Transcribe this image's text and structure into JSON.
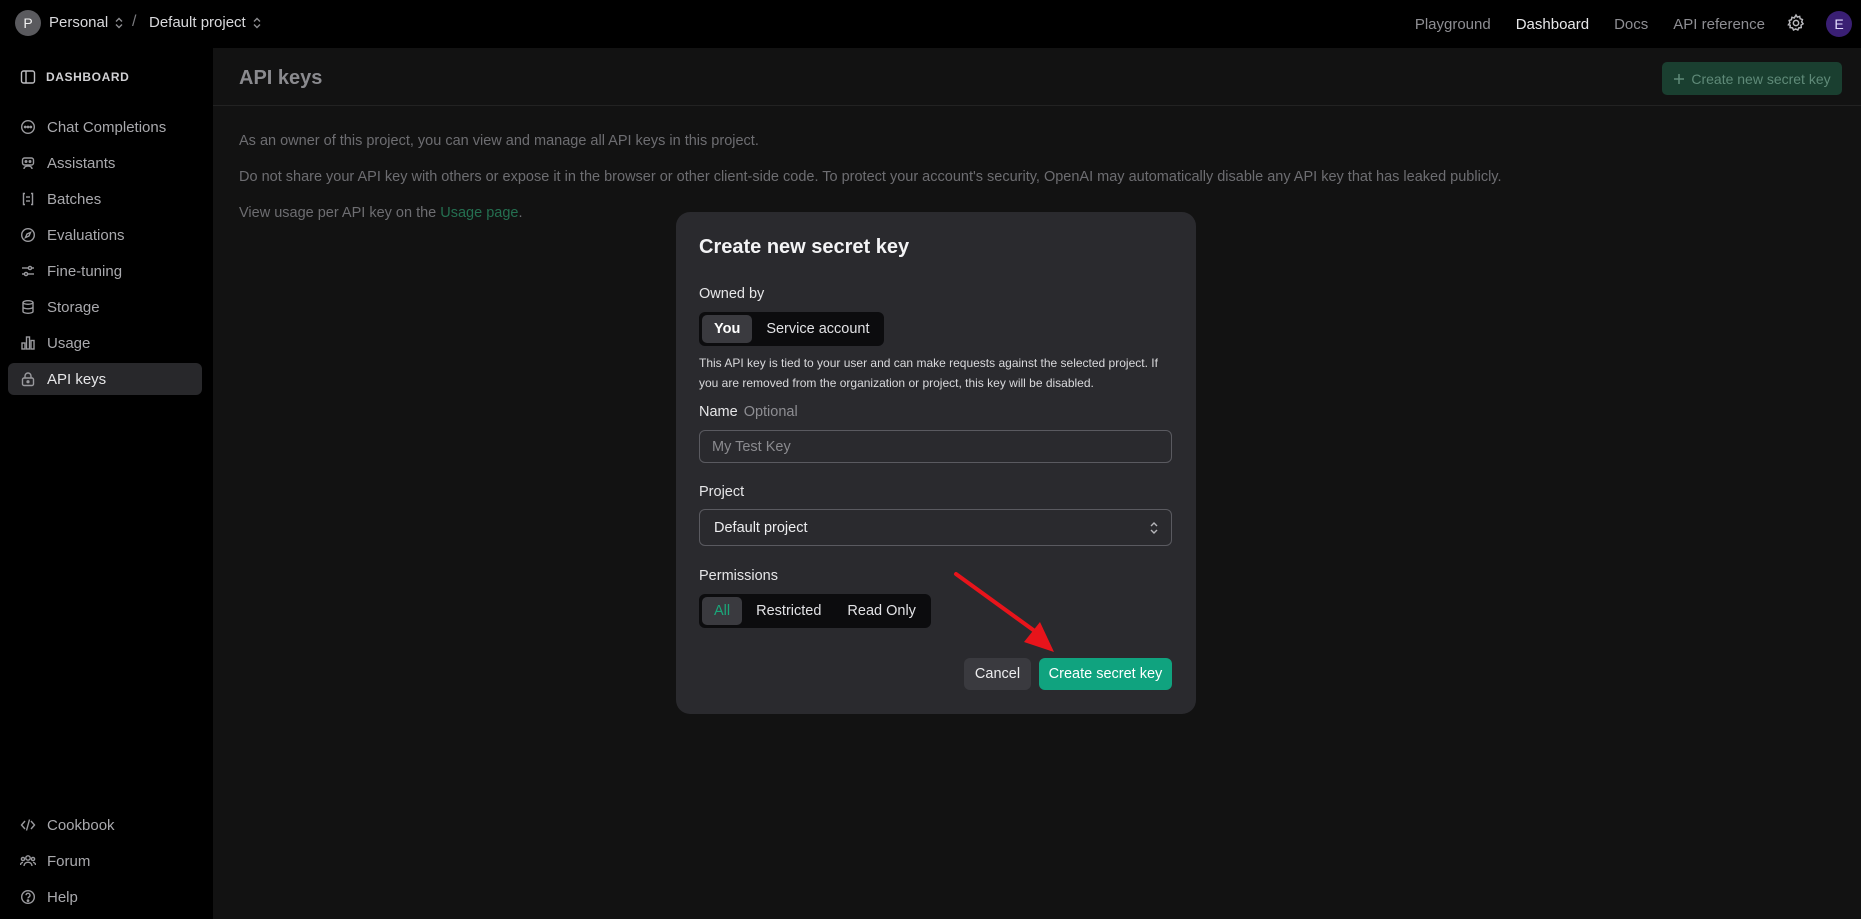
{
  "topbar": {
    "org_initial": "P",
    "org_name": "Personal",
    "separator": "/",
    "project_name": "Default project",
    "links": [
      "Playground",
      "Dashboard",
      "Docs",
      "API reference"
    ],
    "active_link": "Dashboard",
    "user_initial": "E"
  },
  "sidebar": {
    "heading": "DASHBOARD",
    "items": [
      {
        "label": "Chat Completions",
        "icon": "chat-icon"
      },
      {
        "label": "Assistants",
        "icon": "robot-icon"
      },
      {
        "label": "Batches",
        "icon": "batches-icon"
      },
      {
        "label": "Evaluations",
        "icon": "compass-icon"
      },
      {
        "label": "Fine-tuning",
        "icon": "sliders-icon"
      },
      {
        "label": "Storage",
        "icon": "database-icon"
      },
      {
        "label": "Usage",
        "icon": "bar-chart-icon"
      },
      {
        "label": "API keys",
        "icon": "lock-icon",
        "active": true
      }
    ],
    "footer_items": [
      {
        "label": "Cookbook",
        "icon": "code-icon"
      },
      {
        "label": "Forum",
        "icon": "people-icon"
      },
      {
        "label": "Help",
        "icon": "help-icon"
      }
    ]
  },
  "main": {
    "title": "API keys",
    "create_button": "Create new secret key",
    "paragraphs": {
      "p1": "As an owner of this project, you can view and manage all API keys in this project.",
      "p2": "Do not share your API key with others or expose it in the browser or other client-side code. To protect your account's security, OpenAI may automatically disable any API key that has leaked publicly.",
      "p3_prefix": "View usage per API key on the ",
      "p3_link": "Usage page",
      "p3_suffix": "."
    }
  },
  "modal": {
    "title": "Create new secret key",
    "owned_by_label": "Owned by",
    "owned_by_options": [
      "You",
      "Service account"
    ],
    "owned_by_selected": "You",
    "help_text": "This API key is tied to your user and can make requests against the selected project. If you are removed from the organization or project, this key will be disabled.",
    "name_label": "Name",
    "name_optional": "Optional",
    "name_placeholder": "My Test Key",
    "name_value": "",
    "project_label": "Project",
    "project_value": "Default project",
    "permissions_label": "Permissions",
    "permissions_options": [
      "All",
      "Restricted",
      "Read Only"
    ],
    "permissions_selected": "All",
    "cancel_label": "Cancel",
    "create_label": "Create secret key"
  },
  "colors": {
    "accent_green": "#10a37f",
    "annotation_arrow": "#e8141b"
  }
}
